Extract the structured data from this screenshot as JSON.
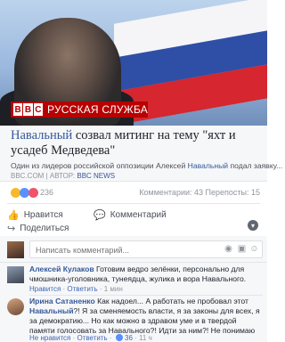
{
  "banner": {
    "brand_letters": [
      "B",
      "B",
      "C"
    ],
    "service": "РУССКАЯ СЛУЖБА"
  },
  "preview": {
    "title_hl": "Навальный",
    "title_rest": " созвал митинг на тему \"яхт и усадеб Медведева\"",
    "subtitle_pre": "Один из лидеров российской оппозиции Алексей ",
    "subtitle_hl": "Навальный",
    "subtitle_post": " подал заявку...",
    "source_site": "BBC.COM",
    "source_sep": " | АВТОР: ",
    "source_author": "BBC NEWS"
  },
  "reactions": {
    "count": "236",
    "comments": "Комментарии: 43",
    "shares": "Перепосты: 15"
  },
  "actions": {
    "like": "Нравится",
    "comment": "Комментарий",
    "share": "Поделиться",
    "like_icon": "👍",
    "comment_icon": "💬",
    "share_icon": "↪"
  },
  "comment_box": {
    "placeholder": "Написать комментарий..."
  },
  "comments": [
    {
      "author": "Алексей Кулаков",
      "text": " Готовим ведро зелёнки, персонально для чмошника-уголовника, тунеядца, жулика и вора Навального.",
      "like": "Нравится",
      "reply": "Ответить",
      "time": "1 мин"
    },
    {
      "author": "Ирина Сатаненко",
      "text_pre": " Как надоел... А работать не пробовал этот ",
      "text_hl": "Навальный",
      "text_post": "?! Я за сменяемость власти, я за законы для всех, я за демократию... Но как можно в здравом уме и в твердой памяти голосовать за Навального?! Идти за ним?! Не понимаю",
      "like": "Не нравится",
      "reply": "Ответить",
      "likes": "36",
      "time": "11 ч"
    }
  ],
  "colors": {
    "link": "#365899",
    "bbc_red": "#b80000",
    "muted": "#90949c"
  }
}
